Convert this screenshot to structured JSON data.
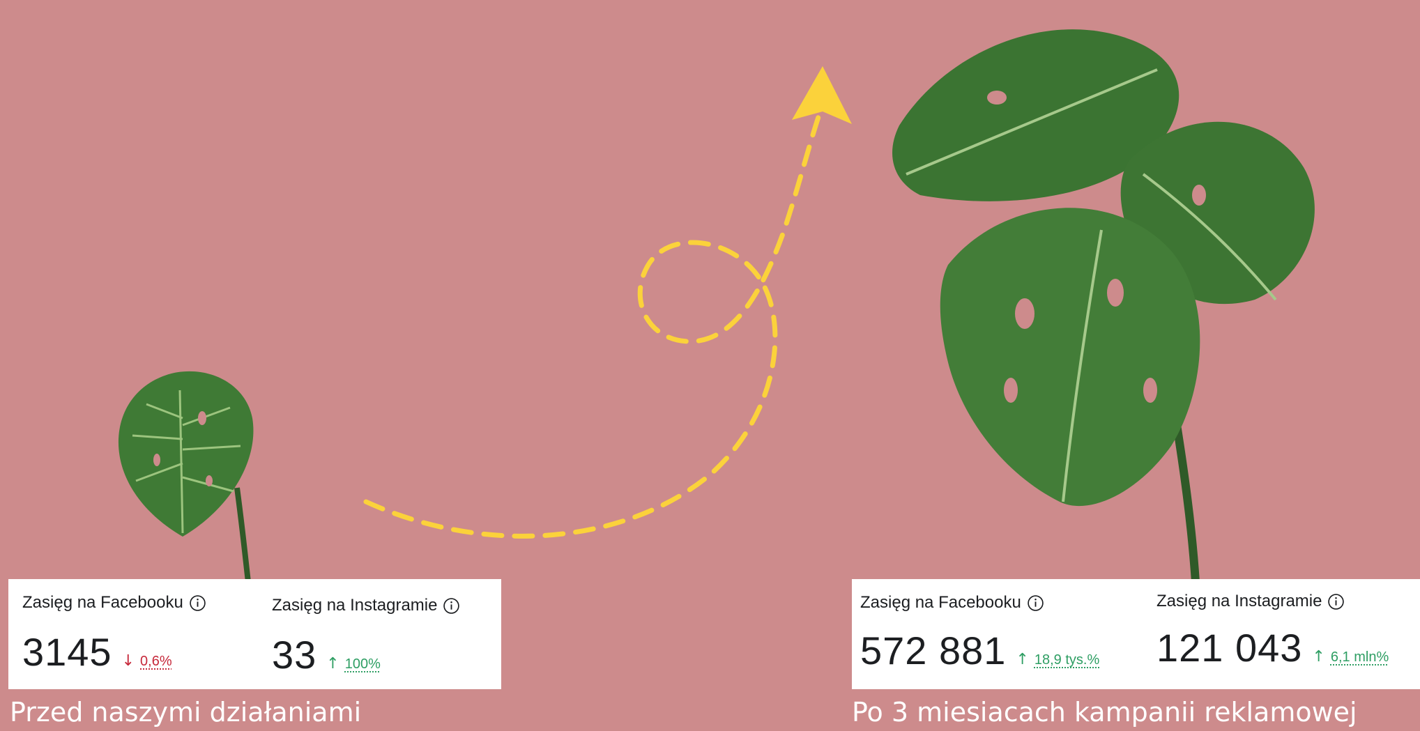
{
  "before": {
    "caption": "Przed naszymi działaniami",
    "facebook": {
      "label": "Zasięg na Facebooku",
      "value": "3145",
      "arrow": "↓",
      "change": "0,6%"
    },
    "instagram": {
      "label": "Zasięg na Instagramie",
      "value": "33",
      "arrow": "↑",
      "change": "100%"
    }
  },
  "after": {
    "caption": "Po 3 miesiacach kampanii reklamowej",
    "facebook": {
      "label": "Zasięg na Facebooku",
      "value": "572 881",
      "arrow": "↑",
      "change": "18,9 tys.%"
    },
    "instagram": {
      "label": "Zasięg na Instagramie",
      "value": "121 043",
      "arrow": "↑",
      "change": "6,1 mln%"
    }
  },
  "colors": {
    "background": "#cd8b8c",
    "arrow": "#fbd23b",
    "decrease": "#c6283a",
    "increase": "#2e9e63",
    "leaf": "#3f7a35"
  },
  "icons": [
    "monstera-small-icon",
    "monstera-large-icon",
    "dashed-loop-arrow-icon",
    "info-icon"
  ]
}
